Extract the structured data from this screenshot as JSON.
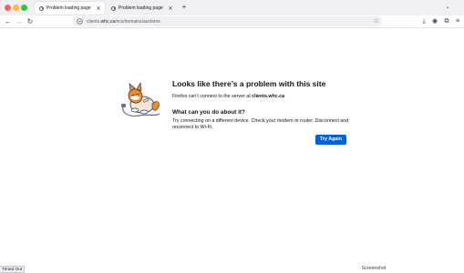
{
  "tabs": [
    {
      "title": "Problem loading page",
      "active": true
    },
    {
      "title": "Problem loading page",
      "active": false
    }
  ],
  "tab_close_glyph": "✕",
  "new_tab_glyph": "+",
  "tab_list_glyph": "⌄",
  "nav": {
    "back_glyph": "←",
    "forward_glyph": "→",
    "reload_glyph": "↻"
  },
  "url": {
    "prefix": "clients.",
    "host": "whc.ca",
    "path": "/ncs/domains/auctions"
  },
  "bookmark_glyph": "☆",
  "toolbar_glyphs": {
    "downloads": "⤓",
    "account": "◉",
    "extensions": "⧉",
    "menu": "≡"
  },
  "error": {
    "title": "Looks like there’s a problem with this site",
    "desc_prefix": "Firefox can’t connect to the server at ",
    "desc_host": "clients.whc.ca",
    "subtitle": "What can you do about it?",
    "advice": "Try connecting on a different device. Check your modem or router. Disconnect and reconnect to Wi-Fi.",
    "button": "Try Again"
  },
  "status_text": "Timed Out",
  "screenshot_label": "Screenshot",
  "colors": {
    "accent": "#0061e0",
    "tabstrip": "#f0f0f4"
  }
}
